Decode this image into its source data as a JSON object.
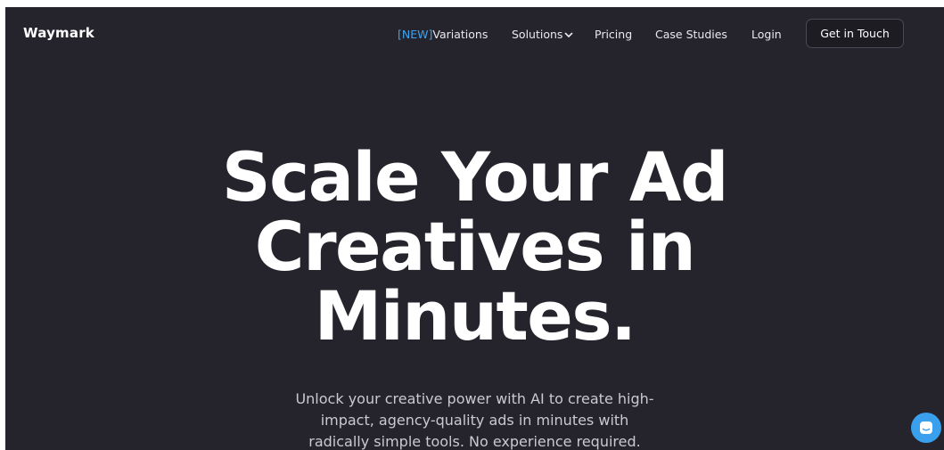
{
  "brand": {
    "logo_text": "Waymark"
  },
  "nav": {
    "variations_tag": "[NEW]",
    "variations_label": "Variations",
    "solutions_label": "Solutions",
    "pricing_label": "Pricing",
    "case_studies_label": "Case Studies",
    "login_label": "Login",
    "cta_label": "Get in Touch"
  },
  "hero": {
    "title_line1": "Scale Your Ad",
    "title_line2": "Creatives in",
    "title_line3": "Minutes.",
    "subtitle_line1": "Unlock your creative power with AI to create high-",
    "subtitle_line2": "impact, agency-quality ads in minutes with",
    "subtitle_line3": "radically simple tools. No experience required."
  },
  "colors": {
    "background": "#25242c",
    "accent": "#3ea3ef",
    "chat_button": "#3aa0ee"
  },
  "icons": {
    "solutions_dropdown": "chevron-down-icon",
    "chat_launcher": "chat-icon"
  }
}
